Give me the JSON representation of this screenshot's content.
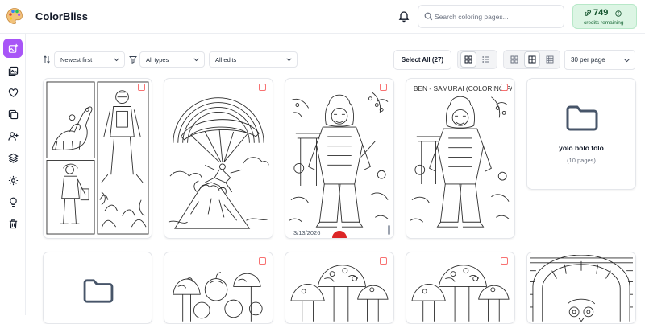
{
  "app": {
    "name": "ColorBliss"
  },
  "header": {
    "search_placeholder": "Search coloring pages...",
    "credits_value": "749",
    "credits_label": "credits remaining"
  },
  "sidebar": {
    "items": [
      {
        "name": "create",
        "icon": "image-plus-icon",
        "active": true
      },
      {
        "name": "gallery",
        "icon": "images-icon"
      },
      {
        "name": "favorites",
        "icon": "heart-icon"
      },
      {
        "name": "collections",
        "icon": "copy-icon"
      },
      {
        "name": "invite",
        "icon": "user-plus-icon"
      },
      {
        "name": "layers",
        "icon": "layers-icon"
      },
      {
        "name": "settings",
        "icon": "gear-icon"
      },
      {
        "name": "ideas",
        "icon": "lightbulb-icon"
      },
      {
        "name": "trash",
        "icon": "trash-icon"
      }
    ]
  },
  "toolbar": {
    "sort_value": "Newest first",
    "type_value": "All types",
    "edit_value": "All edits",
    "select_all": "Select All (27)",
    "per_page": "30 per page"
  },
  "cards": [
    {
      "kind": "image",
      "subject": "dinosaur, firefighter, diver collage"
    },
    {
      "kind": "image",
      "subject": "paraglider over volcano"
    },
    {
      "kind": "image",
      "subject": "samurai warrior",
      "date": "3/13/2026"
    },
    {
      "kind": "image",
      "subject": "samurai coloring page",
      "printed_title": "BEN - SAMURAI (COLORING PAGE)"
    },
    {
      "kind": "folder",
      "name": "yolo bolo folo",
      "meta": "(10 pages)"
    },
    {
      "kind": "folder"
    },
    {
      "kind": "image",
      "subject": "fruit and mushrooms"
    },
    {
      "kind": "image",
      "subject": "mushrooms"
    },
    {
      "kind": "image",
      "subject": "mushrooms"
    },
    {
      "kind": "image",
      "subject": "owl in archway"
    }
  ],
  "colors": {
    "accent": "#a855f7",
    "credits_bg": "#dcf5e4",
    "checkbox": "#f87171",
    "delete": "#dc2626"
  }
}
